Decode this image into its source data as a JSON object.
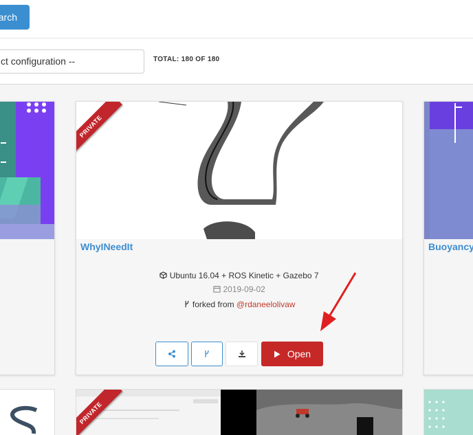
{
  "toolbar": {
    "search_label": "arch"
  },
  "filter": {
    "config_value": "ct configuration --",
    "total_label": "TOTAL: 180 OF 180"
  },
  "cards": [
    {
      "title": ""
    },
    {
      "title": "WhyINeedIt",
      "ribbon": "PRIVATE",
      "config": "Ubuntu 16.04 + ROS Kinetic + Gazebo 7",
      "date": "2019-09-02",
      "forked_prefix": "forked from ",
      "forked_user": "@rdaneelolivaw",
      "buttons": {
        "open": "Open"
      }
    },
    {
      "title": "Buoyancy"
    }
  ],
  "bottom_cards": [
    {
      "ribbon": "PRIVATE"
    }
  ],
  "colors": {
    "accent": "#3b8fd0",
    "danger": "#c62828",
    "title": "#3d8dd1"
  },
  "icons": [
    "cube-icon",
    "calendar-icon",
    "fork-icon",
    "share-icon",
    "download-icon",
    "play-icon"
  ]
}
